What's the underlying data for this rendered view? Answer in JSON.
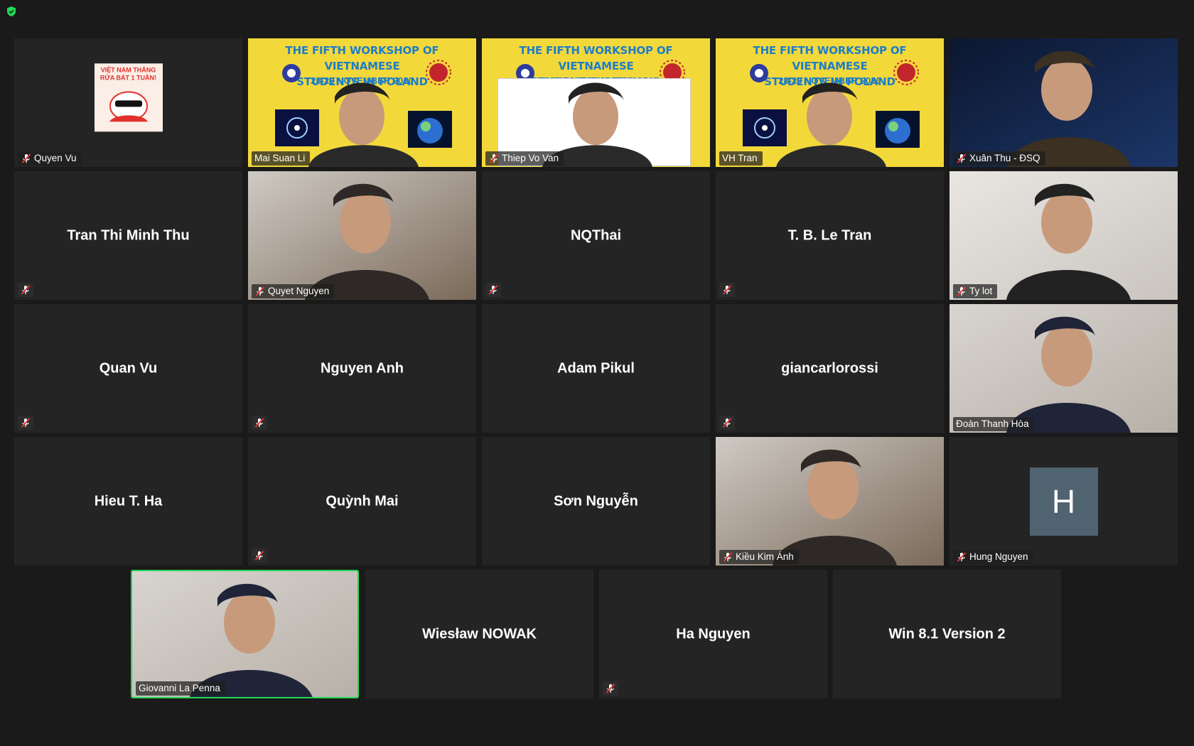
{
  "status": {
    "shield_icon": "green-shield-check"
  },
  "colors": {
    "active_speaker_border": "#23d959",
    "tile_bg": "#242424",
    "page_bg": "#1a1a1a"
  },
  "participants": [
    {
      "name": "Quyen Vu",
      "muted": true,
      "video": "sticker",
      "sticker_text": "VIỆT NAM THẮNG RỬA BÁT 1 TUẦN!"
    },
    {
      "name": "Mai Suan Li",
      "muted": false,
      "video": "poster"
    },
    {
      "name": "Thiep Vo Van",
      "muted": true,
      "video": "poster-doc"
    },
    {
      "name": "VH Tran",
      "muted": false,
      "video": "poster"
    },
    {
      "name": "Xuân Thu - ĐSQ",
      "muted": true,
      "video": "camera"
    },
    {
      "name": "Tran Thi Minh Thu",
      "muted": true,
      "video": "none"
    },
    {
      "name": "Quyet Nguyen",
      "muted": true,
      "video": "camera"
    },
    {
      "name": "NQThai",
      "muted": true,
      "video": "none"
    },
    {
      "name": "T. B. Le Tran",
      "muted": true,
      "video": "none"
    },
    {
      "name": "Ty lot",
      "muted": true,
      "video": "camera"
    },
    {
      "name": "Quan Vu",
      "muted": true,
      "video": "none"
    },
    {
      "name": "Nguyen Anh",
      "muted": true,
      "video": "none"
    },
    {
      "name": "Adam Pikul",
      "muted": false,
      "video": "none"
    },
    {
      "name": "giancarlorossi",
      "muted": true,
      "video": "none"
    },
    {
      "name": "Đoàn Thanh Hòa",
      "muted": false,
      "video": "camera"
    },
    {
      "name": "Hieu T. Ha",
      "muted": false,
      "video": "none"
    },
    {
      "name": "Quỳnh Mai",
      "muted": true,
      "video": "none"
    },
    {
      "name": "Sơn Nguyễn",
      "muted": false,
      "video": "none"
    },
    {
      "name": "Kiều Kim Ánh",
      "muted": true,
      "video": "camera"
    },
    {
      "name": "Hung Nguyen",
      "muted": true,
      "video": "avatar",
      "avatar_letter": "H"
    },
    {
      "name": "Giovanni La Penna",
      "muted": false,
      "video": "camera",
      "active_speaker": true
    },
    {
      "name": "Wiesław NOWAK",
      "muted": false,
      "video": "none"
    },
    {
      "name": "Ha Nguyen",
      "muted": true,
      "video": "none"
    },
    {
      "name": "Win 8.1 Version 2",
      "muted": false,
      "video": "none"
    }
  ],
  "poster": {
    "title_line1": "THE FIFTH WORKSHOP OF VIETNAMESE",
    "title_line2": "STUDENTS IN POLAND",
    "date": "28-29 NOVEMBER 2020"
  }
}
